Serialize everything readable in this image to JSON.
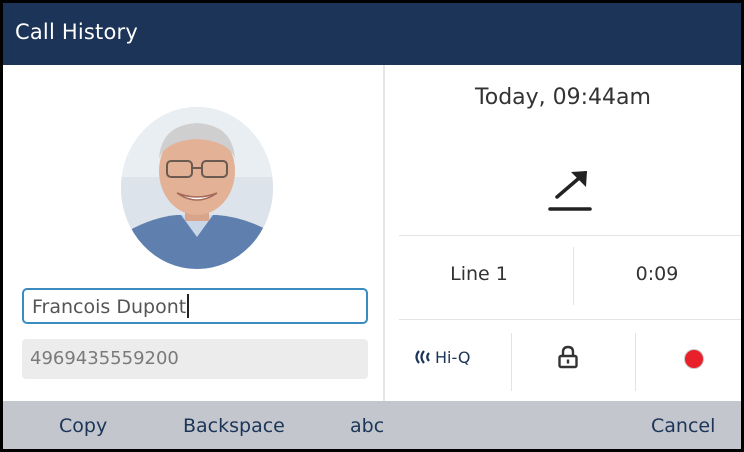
{
  "header": {
    "title": "Call History"
  },
  "contact": {
    "name": "Francois Dupont",
    "number": "4969435559200"
  },
  "call": {
    "datetime": "Today, 09:44am",
    "direction_icon": "outgoing-call-arrow-icon",
    "line": "Line 1",
    "duration": "0:09"
  },
  "status_icons": {
    "hiq_label": "Hi-Q",
    "lock_icon": "lock-icon",
    "record_icon": "record-icon",
    "record_color": "#e8202a"
  },
  "softkeys": {
    "copy": "Copy",
    "backspace": "Backspace",
    "abc": "abc",
    "cancel": "Cancel"
  },
  "colors": {
    "titlebar": "#1b3457",
    "softkey_bar": "#c3c7cd",
    "field_focus": "#3a8cc0"
  }
}
